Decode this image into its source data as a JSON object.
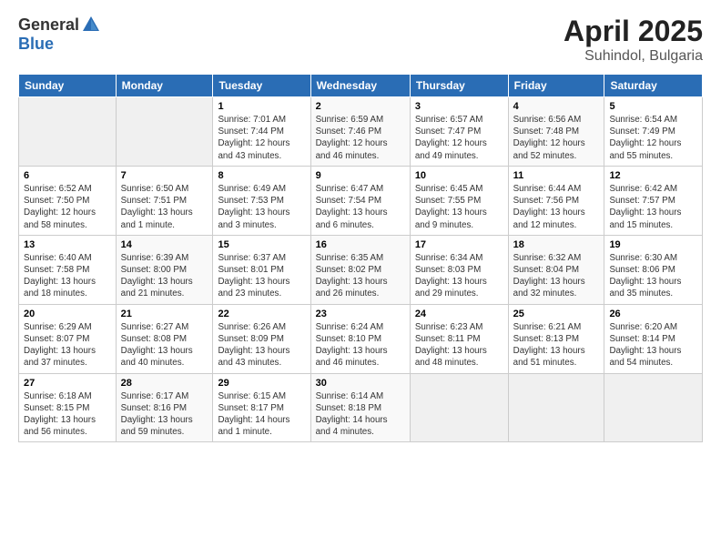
{
  "header": {
    "logo_general": "General",
    "logo_blue": "Blue",
    "title": "April 2025",
    "location": "Suhindol, Bulgaria"
  },
  "calendar": {
    "days_of_week": [
      "Sunday",
      "Monday",
      "Tuesday",
      "Wednesday",
      "Thursday",
      "Friday",
      "Saturday"
    ],
    "rows": [
      [
        {
          "num": "",
          "info": ""
        },
        {
          "num": "",
          "info": ""
        },
        {
          "num": "1",
          "info": "Sunrise: 7:01 AM\nSunset: 7:44 PM\nDaylight: 12 hours\nand 43 minutes."
        },
        {
          "num": "2",
          "info": "Sunrise: 6:59 AM\nSunset: 7:46 PM\nDaylight: 12 hours\nand 46 minutes."
        },
        {
          "num": "3",
          "info": "Sunrise: 6:57 AM\nSunset: 7:47 PM\nDaylight: 12 hours\nand 49 minutes."
        },
        {
          "num": "4",
          "info": "Sunrise: 6:56 AM\nSunset: 7:48 PM\nDaylight: 12 hours\nand 52 minutes."
        },
        {
          "num": "5",
          "info": "Sunrise: 6:54 AM\nSunset: 7:49 PM\nDaylight: 12 hours\nand 55 minutes."
        }
      ],
      [
        {
          "num": "6",
          "info": "Sunrise: 6:52 AM\nSunset: 7:50 PM\nDaylight: 12 hours\nand 58 minutes."
        },
        {
          "num": "7",
          "info": "Sunrise: 6:50 AM\nSunset: 7:51 PM\nDaylight: 13 hours\nand 1 minute."
        },
        {
          "num": "8",
          "info": "Sunrise: 6:49 AM\nSunset: 7:53 PM\nDaylight: 13 hours\nand 3 minutes."
        },
        {
          "num": "9",
          "info": "Sunrise: 6:47 AM\nSunset: 7:54 PM\nDaylight: 13 hours\nand 6 minutes."
        },
        {
          "num": "10",
          "info": "Sunrise: 6:45 AM\nSunset: 7:55 PM\nDaylight: 13 hours\nand 9 minutes."
        },
        {
          "num": "11",
          "info": "Sunrise: 6:44 AM\nSunset: 7:56 PM\nDaylight: 13 hours\nand 12 minutes."
        },
        {
          "num": "12",
          "info": "Sunrise: 6:42 AM\nSunset: 7:57 PM\nDaylight: 13 hours\nand 15 minutes."
        }
      ],
      [
        {
          "num": "13",
          "info": "Sunrise: 6:40 AM\nSunset: 7:58 PM\nDaylight: 13 hours\nand 18 minutes."
        },
        {
          "num": "14",
          "info": "Sunrise: 6:39 AM\nSunset: 8:00 PM\nDaylight: 13 hours\nand 21 minutes."
        },
        {
          "num": "15",
          "info": "Sunrise: 6:37 AM\nSunset: 8:01 PM\nDaylight: 13 hours\nand 23 minutes."
        },
        {
          "num": "16",
          "info": "Sunrise: 6:35 AM\nSunset: 8:02 PM\nDaylight: 13 hours\nand 26 minutes."
        },
        {
          "num": "17",
          "info": "Sunrise: 6:34 AM\nSunset: 8:03 PM\nDaylight: 13 hours\nand 29 minutes."
        },
        {
          "num": "18",
          "info": "Sunrise: 6:32 AM\nSunset: 8:04 PM\nDaylight: 13 hours\nand 32 minutes."
        },
        {
          "num": "19",
          "info": "Sunrise: 6:30 AM\nSunset: 8:06 PM\nDaylight: 13 hours\nand 35 minutes."
        }
      ],
      [
        {
          "num": "20",
          "info": "Sunrise: 6:29 AM\nSunset: 8:07 PM\nDaylight: 13 hours\nand 37 minutes."
        },
        {
          "num": "21",
          "info": "Sunrise: 6:27 AM\nSunset: 8:08 PM\nDaylight: 13 hours\nand 40 minutes."
        },
        {
          "num": "22",
          "info": "Sunrise: 6:26 AM\nSunset: 8:09 PM\nDaylight: 13 hours\nand 43 minutes."
        },
        {
          "num": "23",
          "info": "Sunrise: 6:24 AM\nSunset: 8:10 PM\nDaylight: 13 hours\nand 46 minutes."
        },
        {
          "num": "24",
          "info": "Sunrise: 6:23 AM\nSunset: 8:11 PM\nDaylight: 13 hours\nand 48 minutes."
        },
        {
          "num": "25",
          "info": "Sunrise: 6:21 AM\nSunset: 8:13 PM\nDaylight: 13 hours\nand 51 minutes."
        },
        {
          "num": "26",
          "info": "Sunrise: 6:20 AM\nSunset: 8:14 PM\nDaylight: 13 hours\nand 54 minutes."
        }
      ],
      [
        {
          "num": "27",
          "info": "Sunrise: 6:18 AM\nSunset: 8:15 PM\nDaylight: 13 hours\nand 56 minutes."
        },
        {
          "num": "28",
          "info": "Sunrise: 6:17 AM\nSunset: 8:16 PM\nDaylight: 13 hours\nand 59 minutes."
        },
        {
          "num": "29",
          "info": "Sunrise: 6:15 AM\nSunset: 8:17 PM\nDaylight: 14 hours\nand 1 minute."
        },
        {
          "num": "30",
          "info": "Sunrise: 6:14 AM\nSunset: 8:18 PM\nDaylight: 14 hours\nand 4 minutes."
        },
        {
          "num": "",
          "info": ""
        },
        {
          "num": "",
          "info": ""
        },
        {
          "num": "",
          "info": ""
        }
      ]
    ]
  }
}
